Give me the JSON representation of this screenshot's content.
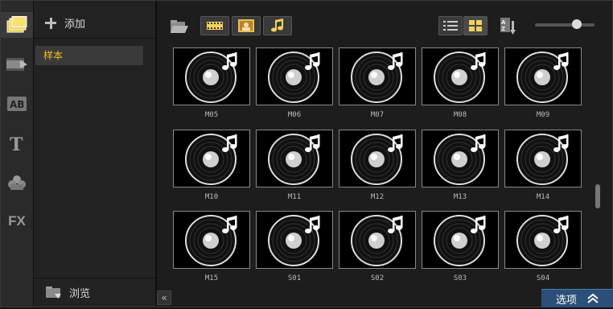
{
  "library": {
    "add_label": "添加",
    "selected_item": "样本",
    "browse_label": "浏览"
  },
  "rail": {
    "items": [
      "media-library-icon",
      "transition-icon",
      "title-ab-icon",
      "text-icon",
      "graphics-icon",
      "fx-icon"
    ],
    "fx_label": "FX"
  },
  "toolbar": {
    "buttons": [
      "folder-icon",
      "video-filter-icon",
      "photo-filter-icon",
      "audio-filter-icon",
      "list-view-icon",
      "thumbnail-view-icon",
      "sort-icon"
    ]
  },
  "thumbnails": [
    "M05",
    "M06",
    "M07",
    "M08",
    "M09",
    "M10",
    "M11",
    "M12",
    "M13",
    "M14",
    "M15",
    "S01",
    "S02",
    "S03",
    "S04"
  ],
  "footer": {
    "options_label": "选项",
    "collapse_glyph": "«"
  },
  "colors": {
    "accent": "#f0c020",
    "options_bg": "#2b4f79"
  }
}
